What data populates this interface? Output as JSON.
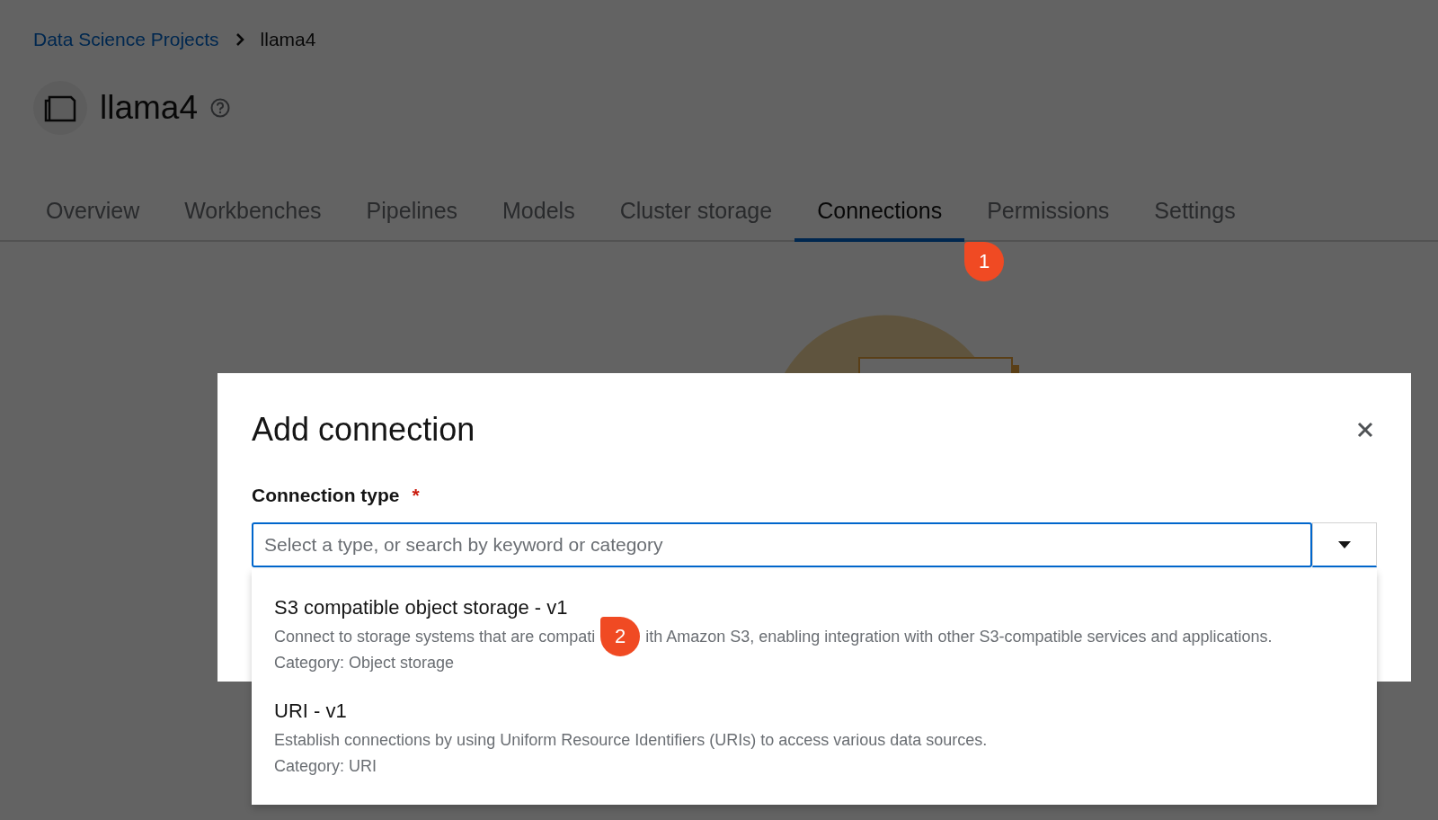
{
  "breadcrumb": [
    {
      "label": "Data Science Projects",
      "kind": "link"
    },
    {
      "label": "llama4",
      "kind": "current"
    }
  ],
  "project": {
    "title": "llama4"
  },
  "tabs": [
    {
      "label": "Overview",
      "selected": false
    },
    {
      "label": "Workbenches",
      "selected": false
    },
    {
      "label": "Pipelines",
      "selected": false
    },
    {
      "label": "Models",
      "selected": false
    },
    {
      "label": "Cluster storage",
      "selected": false
    },
    {
      "label": "Connections",
      "selected": true,
      "callout": "1"
    },
    {
      "label": "Permissions",
      "selected": false
    },
    {
      "label": "Settings",
      "selected": false
    }
  ],
  "dialog": {
    "title": "Add connection",
    "field": {
      "label": "Connection type",
      "required_mark": "*",
      "placeholder": "Select a type, or search by keyword or category"
    },
    "options": [
      {
        "title": "S3 compatible object storage - v1",
        "description_parts": [
          "Connect to storage systems that are compati",
          "ith Amazon S3, enabling integration with other S3-compatible services and applications."
        ],
        "callout": "2",
        "category": "Category: Object storage"
      },
      {
        "title": "URI - v1",
        "description_parts": [
          "Establish connections by using Uniform Resource Identifiers (URIs) to access various data sources."
        ],
        "category": "Category: URI"
      }
    ]
  }
}
